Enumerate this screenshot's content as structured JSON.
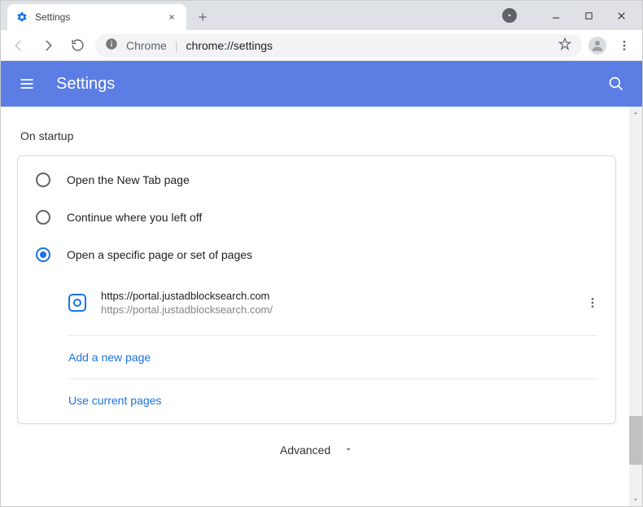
{
  "tab": {
    "title": "Settings"
  },
  "omnibox": {
    "scheme": "Chrome",
    "path": "chrome://settings"
  },
  "header": {
    "title": "Settings"
  },
  "section": {
    "title": "On startup"
  },
  "radios": {
    "newtab": "Open the New Tab page",
    "continue": "Continue where you left off",
    "specific": "Open a specific page or set of pages"
  },
  "pages": [
    {
      "title": "https://portal.justadblocksearch.com",
      "url": "https://portal.justadblocksearch.com/"
    }
  ],
  "actions": {
    "add_page": "Add a new page",
    "use_current": "Use current pages"
  },
  "advanced": "Advanced"
}
